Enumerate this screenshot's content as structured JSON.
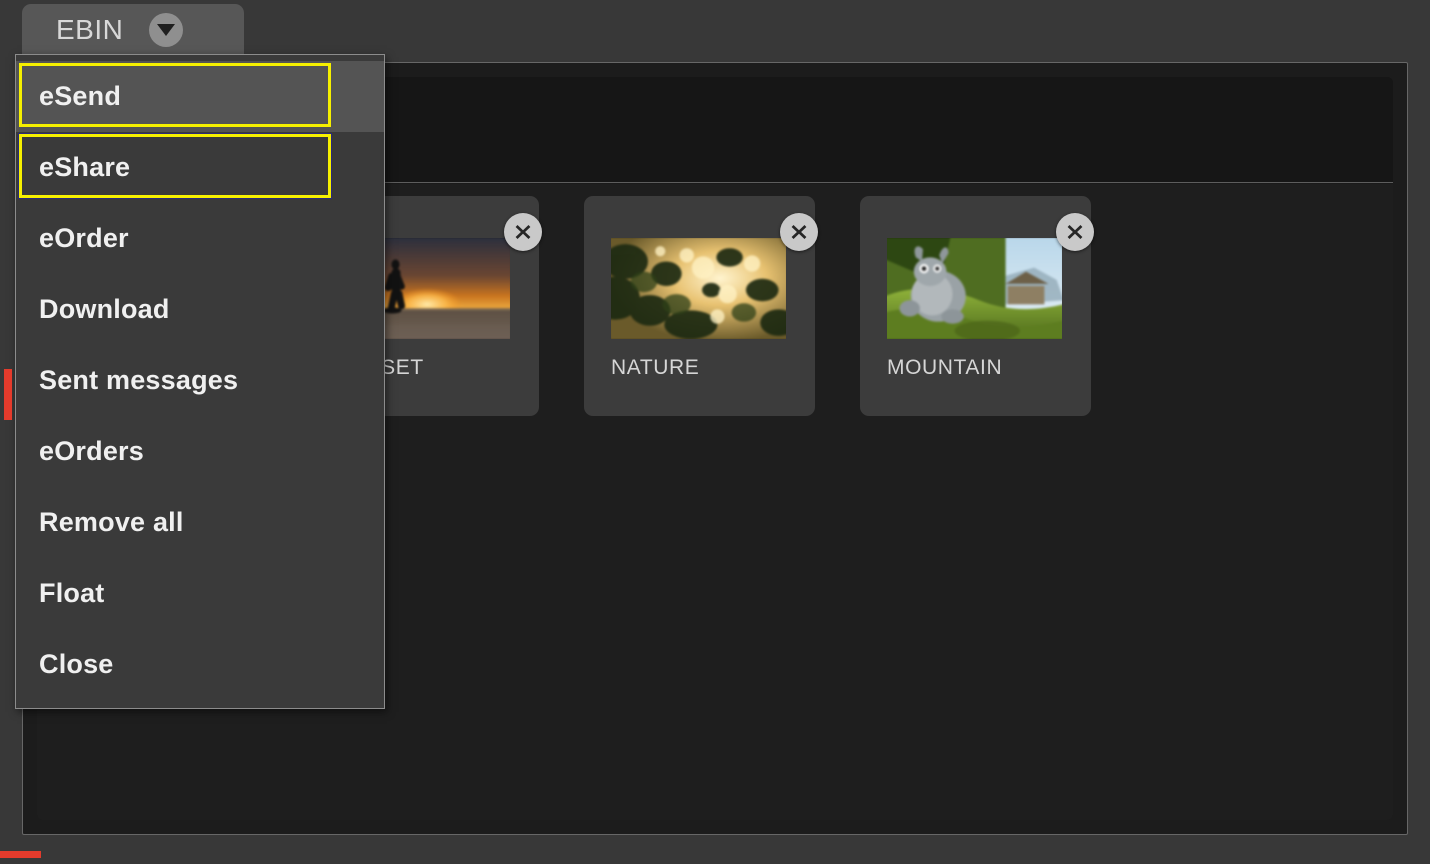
{
  "tab": {
    "title": "EBIN",
    "caret_icon": "chevron-down-icon"
  },
  "menu": {
    "items": [
      {
        "label": "eSend",
        "state": "hovered-focused"
      },
      {
        "label": "eShare",
        "state": "focused"
      },
      {
        "label": "eOrder",
        "state": "normal"
      },
      {
        "label": "Download",
        "state": "normal"
      },
      {
        "label": "Sent messages",
        "state": "normal"
      },
      {
        "label": "eOrders",
        "state": "normal"
      },
      {
        "label": "Remove all",
        "state": "normal"
      },
      {
        "label": "Float",
        "state": "normal"
      },
      {
        "label": "Close",
        "state": "normal"
      }
    ]
  },
  "bin": {
    "cards": [
      {
        "label": "SUNSET",
        "close_icon": "close-circle-icon",
        "thumb": "sunset"
      },
      {
        "label": "NATURE",
        "close_icon": "close-circle-icon",
        "thumb": "nature"
      },
      {
        "label": "MOUNTAIN",
        "close_icon": "close-circle-icon",
        "thumb": "mountain"
      }
    ]
  },
  "colors": {
    "focus_outline": "#f6f000",
    "marker": "#e43b2c",
    "tab_background": "#575757",
    "menu_background": "#3a3a3a",
    "card_background": "#3c3c3c",
    "panel_background": "#1e1e1e"
  }
}
